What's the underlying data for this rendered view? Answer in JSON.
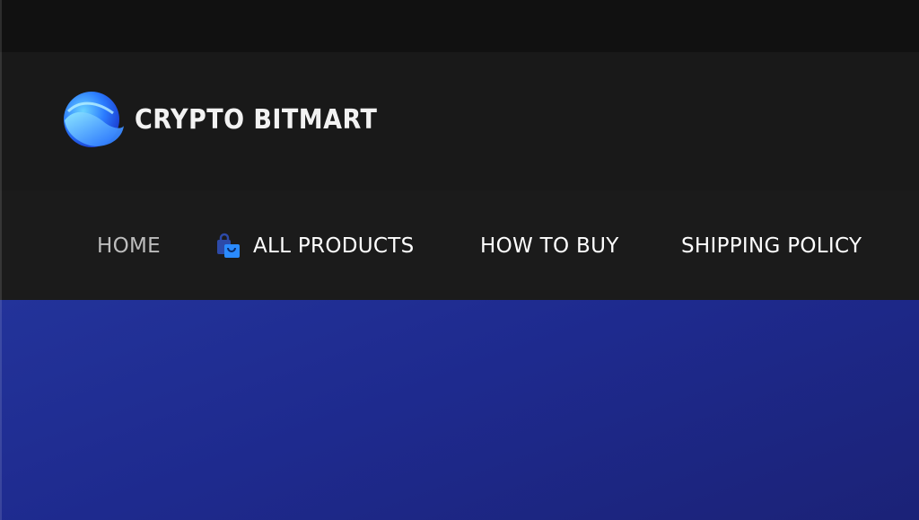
{
  "brand": {
    "name": "CRYPTO BITMART",
    "icon": "blue-sphere-logo-icon"
  },
  "nav": {
    "items": [
      {
        "label": "HOME",
        "active": true
      },
      {
        "label": "ALL PRODUCTS",
        "icon": "shopping-bag-icon"
      },
      {
        "label": "HOW TO BUY"
      },
      {
        "label": "SHIPPING POLICY"
      }
    ]
  },
  "colors": {
    "topbar": "#111111",
    "header": "#191919",
    "nav": "#1b1b1b",
    "hero": "#1e2a8e",
    "logo_blue": "#2f6bff"
  }
}
